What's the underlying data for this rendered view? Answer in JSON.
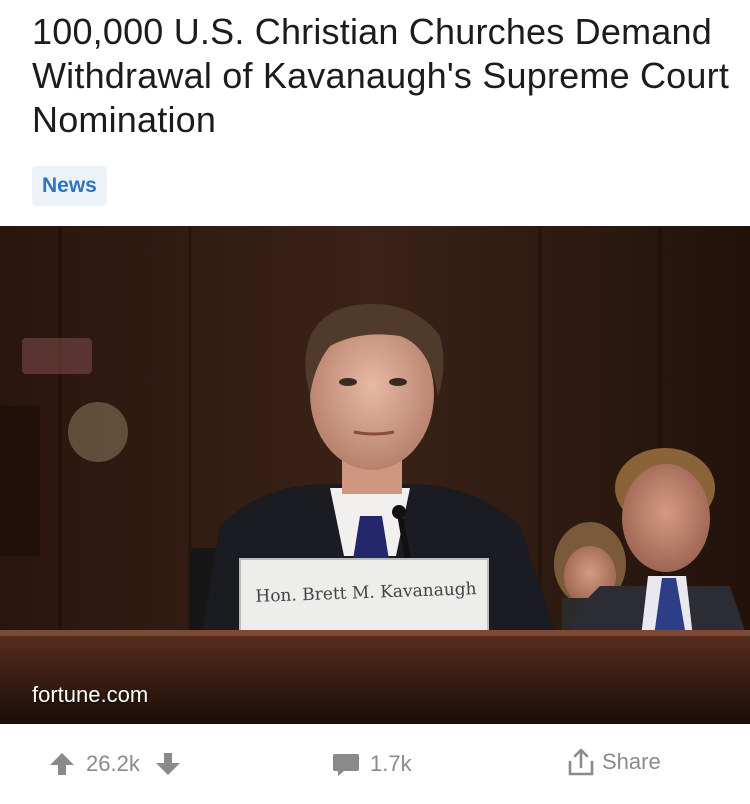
{
  "post": {
    "title": "100,000 U.S. Christian Churches Demand Withdrawal of Kavanaugh's Supreme Court Nomination",
    "flair": "News",
    "domain": "fortune.com",
    "nameplate": "Hon. Brett M. Kavanaugh"
  },
  "actions": {
    "score": "26.2k",
    "comments": "1.7k",
    "share_label": "Share"
  },
  "colors": {
    "flair_text": "#2f74c0",
    "flair_bg": "#edf2f8",
    "action_gray": "#8a8a8a"
  },
  "icons": [
    "upvote-arrow-icon",
    "downvote-arrow-icon",
    "comment-bubble-icon",
    "share-icon"
  ]
}
